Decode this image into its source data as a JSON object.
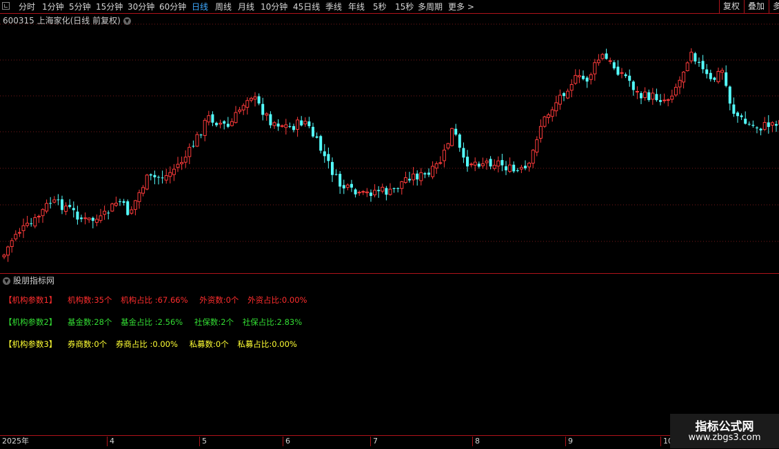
{
  "toolbar": {
    "periods": [
      "分时",
      "1分钟",
      "5分钟",
      "15分钟",
      "30分钟",
      "60分钟",
      "日线",
      "周线",
      "月线",
      "10分钟",
      "45日线",
      "季线",
      "年线",
      "5秒",
      "15秒",
      "多周期",
      "更多 >"
    ],
    "active_period": "日线",
    "right_buttons": [
      "复权",
      "叠加",
      "多"
    ]
  },
  "chart": {
    "title": "600315 上海家化(日线 前复权)",
    "up_color": "#ff3b3b",
    "down_color": "#54ffff",
    "grid_color": "#7a1a1a"
  },
  "indicator": {
    "title": "股朋指标网",
    "rows": [
      {
        "items": [
          "【机构参数1】",
          "机构数:35个",
          "机构占比 :67.66%",
          "外资数:0个",
          "外资占比:0.00%"
        ],
        "color": "#ff2d2d"
      },
      {
        "items": [
          "【机构参数2】",
          "基金数:28个",
          "基金占比 :2.56%",
          "社保数:2个",
          "社保占比:2.83%"
        ],
        "color": "#33dd33"
      },
      {
        "items": [
          "【机构参数3】",
          "券商数:0个",
          "券商占比 :0.00%",
          "私募数:0个",
          "私募占比:0.00%"
        ],
        "color": "#ffff33"
      }
    ]
  },
  "xaxis": {
    "labels": [
      "2025年",
      "4",
      "5",
      "6",
      "7",
      "8",
      "9",
      "10"
    ]
  },
  "watermark": {
    "title": "指标公式网",
    "url": "www.zbgs3.com"
  }
}
